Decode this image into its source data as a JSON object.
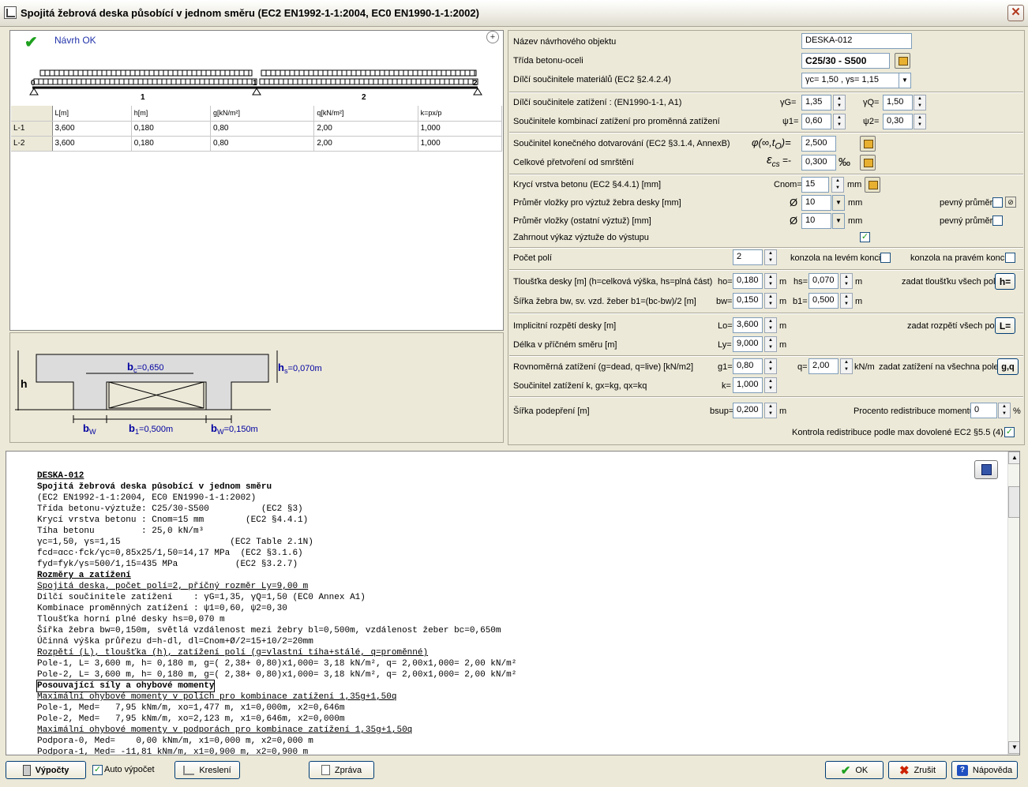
{
  "window": {
    "title": "Spojitá žebrová deska působící v jednom směru (EC2 EN1992-1-1:2004, EC0 EN1990-1-1:2002)",
    "close": "✕"
  },
  "status": {
    "text": "Návrh OK"
  },
  "beam": {
    "support_labels": [
      "0",
      "1",
      "2"
    ],
    "span_labels": [
      "1",
      "2"
    ]
  },
  "table": {
    "headers": [
      "L[m]",
      "h[m]",
      "g[kN/m²]",
      "q[kN/m²]",
      "k=px/p"
    ],
    "rows": [
      {
        "label": "L-1",
        "cells": [
          "3,600",
          "0,180",
          "0,80",
          "2,00",
          "1,000"
        ]
      },
      {
        "label": "L-2",
        "cells": [
          "3,600",
          "0,180",
          "0,80",
          "2,00",
          "1,000"
        ]
      }
    ]
  },
  "section": {
    "h": "h",
    "bc": "b",
    "bc_sub": "c",
    "bc_val": "=0,650",
    "hs": "h",
    "hs_sub": "s",
    "hs_val": "=0,070m",
    "bw": "b",
    "bw_sub": "W",
    "b1": "b",
    "b1_sub": "1",
    "b1_val": "=0,500m",
    "bw2": "b",
    "bw2_sub": "W",
    "bw2_val": "=0,150m"
  },
  "form": {
    "name_label": "Název návrhového objektu",
    "name_value": "DESKA-012",
    "class_label": "Třída betonu-oceli",
    "class_value": "C25/30 - S500",
    "mat_label": "Dílčí součinitele materiálů (EC2 §2.4.2.4)",
    "mat_value": "γc= 1,50 , γs= 1,15",
    "load_factor_label": "Dílčí součinitele zatížení   : (EN1990-1-1, A1)",
    "gG_label": "γG=",
    "gG_value": "1,35",
    "gQ_label": "γQ=",
    "gQ_value": "1,50",
    "comb_label": "Součinitele kombinací zatížení pro proměnná zatížení",
    "psi1_label": "ψ1=",
    "psi1_value": "0,60",
    "psi2_label": "ψ2=",
    "psi2_value": "0,30",
    "creep_label": "Součinitel konečného dotvarování (EC2 §3.1.4, AnnexB)",
    "creep_sym": "φ(∞,t",
    "creep_sub": "O",
    "creep_end": ")=",
    "creep_value": "2,500",
    "shrink_label": "Celkové přetvoření od smrštění",
    "shrink_sym": "ε",
    "shrink_sub": "cs",
    "shrink_end": " =-",
    "shrink_value": "0,300",
    "shrink_unit": "‰",
    "cover_label": "Krycí vrstva betonu (EC2 §4.4.1) [mm]",
    "cnom_label": "Cnom=",
    "cnom_value": "15",
    "cnom_unit": "mm",
    "dia1_label": "Průměr vložky pro výztuž žebra desky [mm]",
    "dia_sym": "Ø",
    "dia1_value": "10",
    "dia_unit": "mm",
    "fixed_dia_label": "pevný průměr",
    "dia2_label": "Průměr vložky (ostatní výztuž) [mm]",
    "dia2_value": "10",
    "include_label": "Zahrnout výkaz výztuže do výstupu",
    "spans_label": "Počet polí",
    "spans_value": "2",
    "left_cant_label": "konzola na levém konci",
    "right_cant_label": "konzola na pravém konci",
    "thick_label": "Tloušťka desky [m] (h=celková výška, hs=plná část)",
    "ho_label": "ho=",
    "ho_value": "0,180",
    "m": "m",
    "hs_label": "hs=",
    "hs_value": "0,070",
    "all_thick_label": "zadat tloušťku všech polí",
    "h_btn": "h=",
    "width_label": "Šířka žebra bw, sv. vzd. žeber  b1=(bc-bw)/2 [m]",
    "bw_label": "bw=",
    "bw_value": "0,150",
    "b1_label": "b1=",
    "b1_value": "0,500",
    "span_label": "Implicitní rozpětí desky [m]",
    "lo_label": "Lo=",
    "lo_value": "3,600",
    "all_span_label": "zadat rozpětí všech polí",
    "l_btn": "L=",
    "trans_label": "Délka v příčném směru [m]",
    "ly_label": "Ly=",
    "ly_value": "9,000",
    "load_label": "Rovnoměrná zatížení (g=dead, q=live) [kN/m2]",
    "g1_label": "g1=",
    "g1_value": "0,80",
    "q_label": "q=",
    "q_value": "2,00",
    "load_unit": "kN/m",
    "all_load_label": "zadat zatížení na všechna pole",
    "gq_btn": "g,q",
    "k_label": "Součinitel zatížení k, gx=kg, qx=kq",
    "k_label2": "k=",
    "k_value": "1,000",
    "bsup_title": "Šířka podepření [m]",
    "bsup_label": "bsup=",
    "bsup_value": "0,200",
    "redis_label": "Procento redistribuce momentů",
    "redis_value": "0",
    "pct": "%",
    "check_label": "Kontrola redistribuce podle max dovolené EC2  §5.5 (4)"
  },
  "report": {
    "lines": [
      {
        "t": "DESKA-012",
        "s": "bu"
      },
      {
        "t": "Spojitá žebrová deska působící v jednom směru",
        "s": "b"
      },
      {
        "t": "(EC2 EN1992-1-1:2004, EC0 EN1990-1-1:2002)",
        "s": ""
      },
      {
        "t": "Třída betonu-výztuže: C25/30-S500          (EC2 §3)",
        "s": ""
      },
      {
        "t": "Krycí vrstva betonu : Cnom=15 mm        (EC2 §4.4.1)",
        "s": ""
      },
      {
        "t": "Tíha betonu         : 25,0 kN/m³",
        "s": ""
      },
      {
        "t": "γc=1,50, γs=1,15                     (EC2 Table 2.1N)",
        "s": ""
      },
      {
        "t": "fcd=αcc·fck/γc=0,85x25/1,50=14,17 MPa  (EC2 §3.1.6)",
        "s": ""
      },
      {
        "t": "fyd=fyk/γs=500/1,15=435 MPa           (EC2 §3.2.7)",
        "s": ""
      },
      {
        "t": "Rozměry a zatížení",
        "s": "bu"
      },
      {
        "t": "Spojitá deska, počet polí=2, příčný rozměr Ly=9,00 m",
        "s": "u"
      },
      {
        "t": "Dílčí součinitele zatížení    : γG=1,35, γQ=1,50 (EC0 Annex A1)",
        "s": ""
      },
      {
        "t": "Kombinace proměnných zatížení : ψ1=0,60, ψ2=0,30",
        "s": ""
      },
      {
        "t": "Tloušťka horní plné desky hs=0,070 m",
        "s": ""
      },
      {
        "t": "Šířka žebra bw=0,150m, světlá vzdálenost mezi žebry bl=0,500m, vzdálenost žeber bc=0,650m",
        "s": ""
      },
      {
        "t": "Účinná výška průřezu d=h-dl, dl=Cnom+Ø/2=15+10/2=20mm",
        "s": ""
      },
      {
        "t": "Rozpětí (L), tloušťka (h), zatížení polí (g=vlastní tíha+stálé, q=proměnné)",
        "s": "u"
      },
      {
        "t": "Pole-1, L= 3,600 m, h= 0,180 m, g=( 2,38+ 0,80)x1,000= 3,18 kN/m², q= 2,00x1,000= 2,00 kN/m²",
        "s": ""
      },
      {
        "t": "Pole-2, L= 3,600 m, h= 0,180 m, g=( 2,38+ 0,80)x1,000= 3,18 kN/m², q= 2,00x1,000= 2,00 kN/m²",
        "s": ""
      },
      {
        "t": "Posouvající síly a ohybové momenty",
        "s": "bx"
      },
      {
        "t": "Maximální ohybové momenty v polích pro kombinace zatížení 1,35g+1,50q",
        "s": "u"
      },
      {
        "t": "Pole-1, Med=   7,95 kNm/m, xo=1,477 m, x1=0,000m, x2=0,646m",
        "s": ""
      },
      {
        "t": "Pole-2, Med=   7,95 kNm/m, xo=2,123 m, x1=0,646m, x2=0,000m",
        "s": ""
      },
      {
        "t": "Maximální ohybové momenty v podporách pro kombinace zatížení 1,35g+1,50q",
        "s": "u"
      },
      {
        "t": "Podpora-0, Med=    0,00 kNm/m, x1=0,000 m, x2=0,000 m",
        "s": ""
      },
      {
        "t": "Podpora-1, Med= -11,81 kNm/m, x1=0,900 m, x2=0,900 m",
        "s": ""
      }
    ]
  },
  "bottom": {
    "calc": "Výpočty",
    "auto": "Auto výpočet",
    "draw": "Kreslení",
    "report": "Zpráva",
    "ok": "OK",
    "cancel": "Zrušit",
    "help": "Nápověda"
  }
}
